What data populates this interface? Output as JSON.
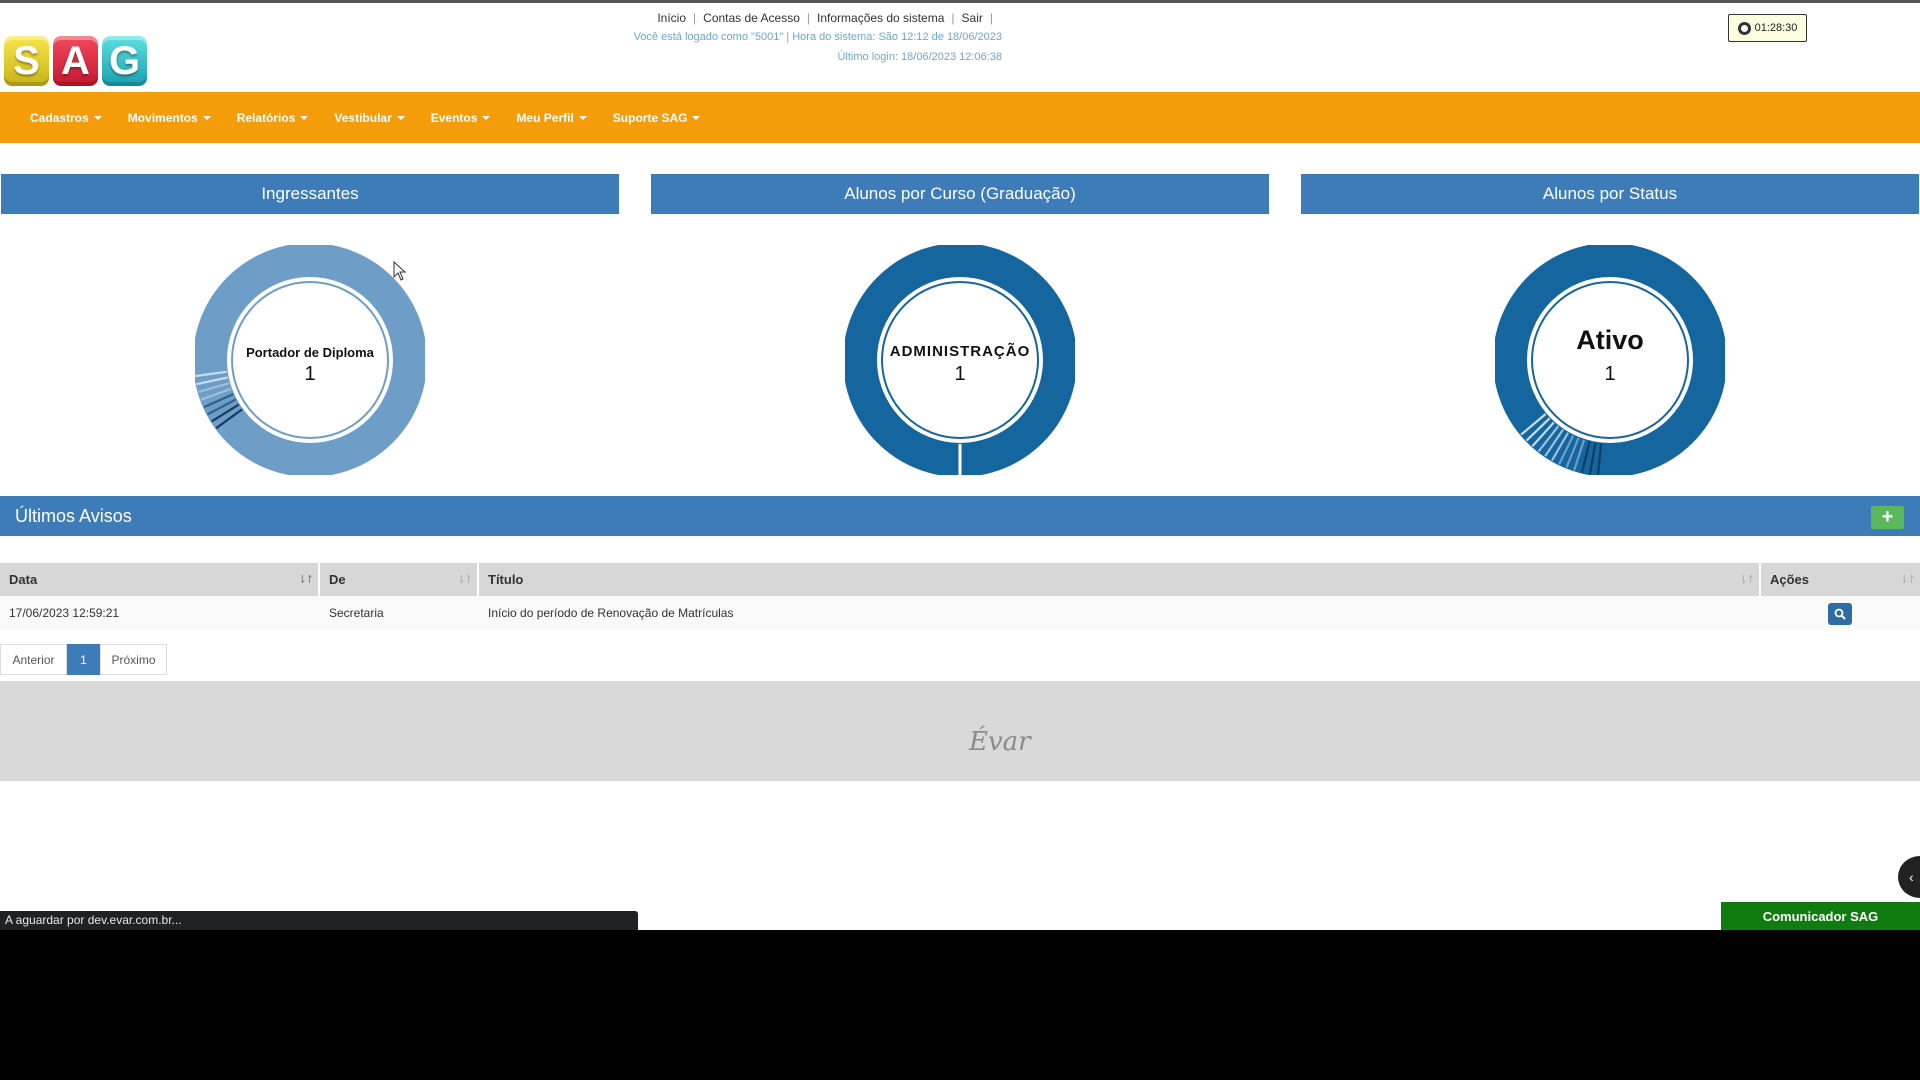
{
  "header": {
    "links": [
      "Início",
      "Contas de Acesso",
      "Informações do sistema",
      "Sair"
    ],
    "login_info": "Você está logado como \"5001\" | Hora do sistema: São 12:12 de 18/06/2023",
    "last_login": "Último login: 18/06/2023 12:06:38",
    "session_timer": "01:28:30",
    "logo_letters": [
      "S",
      "A",
      "G"
    ]
  },
  "nav": {
    "items": [
      "Cadastros",
      "Movimentos",
      "Relatórios",
      "Vestibular",
      "Eventos",
      "Meu Perfil",
      "Suporte SAG"
    ]
  },
  "panels": [
    {
      "title": "Ingressantes",
      "label": "Portador de Diploma",
      "value": "1",
      "color": "#6e9ec8"
    },
    {
      "title": "Alunos por Curso (Graduação)",
      "label": "ADMINISTRAÇÃO",
      "value": "1",
      "color": "#15659f"
    },
    {
      "title": "Alunos por Status",
      "label": "Ativo",
      "value": "1",
      "color": "#15659f"
    }
  ],
  "avisos": {
    "title": "Últimos Avisos",
    "add_label": "+",
    "columns": [
      "Data",
      "De",
      "Título",
      "Ações"
    ],
    "rows": [
      {
        "data": "17/06/2023 12:59:21",
        "de": "Secretaria",
        "titulo": "Início do período de Renovação de Matrículas"
      }
    ]
  },
  "pagination": {
    "prev": "Anterior",
    "current": "1",
    "next": "Próximo"
  },
  "footer": {
    "brand": "Évar"
  },
  "browser": {
    "status": "A aguardar por dev.evar.com.br..."
  },
  "chat": {
    "label": "Comunicador SAG"
  },
  "icons": {
    "timer": "clock-icon",
    "view": "search-icon",
    "add": "plus-icon",
    "side": "chevron-left-icon"
  }
}
